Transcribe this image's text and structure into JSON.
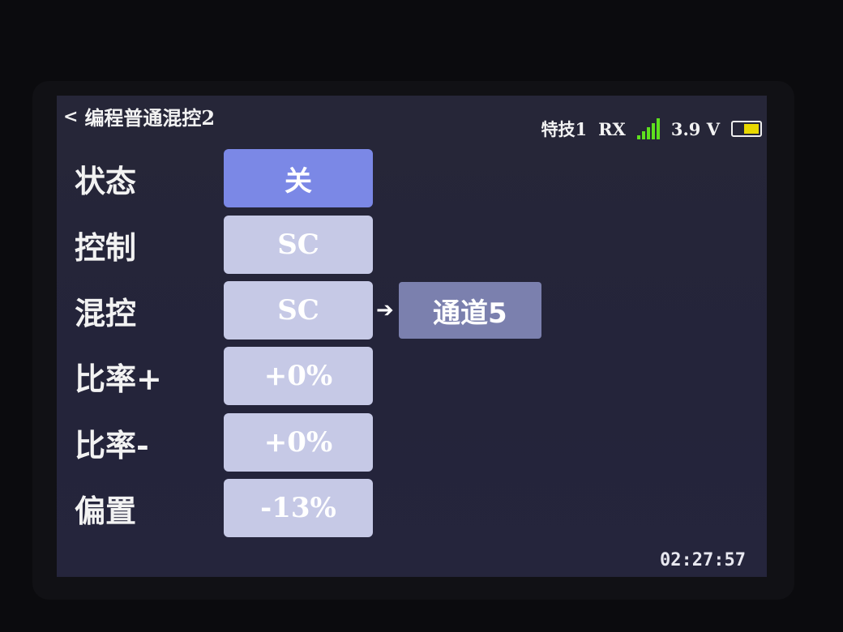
{
  "header": {
    "back_icon": "chevron-left-icon",
    "back_glyph": "<",
    "title": "编程普通混控2"
  },
  "status": {
    "model": "特技1",
    "rx": "RX",
    "voltage": "3.9 V",
    "signal_bars": 5,
    "battery_level": 0.6,
    "signal_color": "#5ee01e",
    "battery_color": "#e8d800"
  },
  "rows": [
    {
      "label": "状态",
      "value": "关"
    },
    {
      "label": "控制",
      "value": "SC"
    },
    {
      "label": "混控",
      "value": "SC",
      "arrow": "➔",
      "target": "通道5"
    },
    {
      "label": "比率+",
      "value": "+0%"
    },
    {
      "label": "比率-",
      "value": "+0%"
    },
    {
      "label": "偏置",
      "value": "-13%"
    }
  ],
  "clock": "02:27:57"
}
